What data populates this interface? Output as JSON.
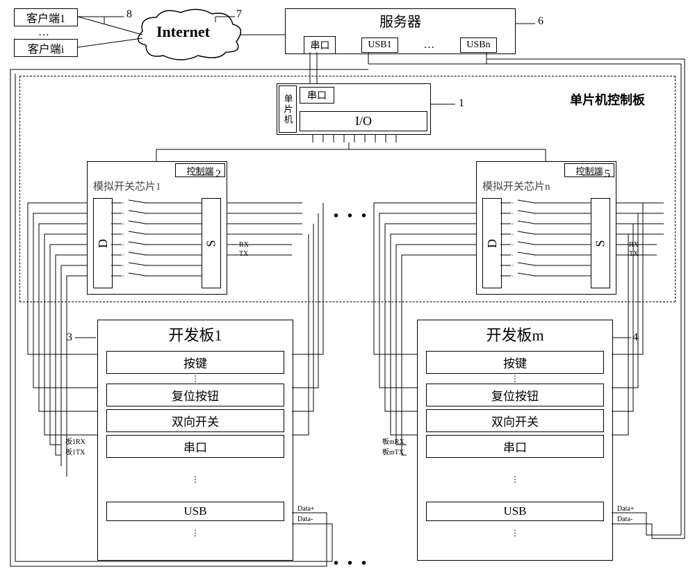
{
  "top": {
    "client1": "客户端1",
    "client_i": "客户端i",
    "client_dots": "…",
    "cloud": "Internet",
    "server": "服务器",
    "server_serial": "串口",
    "server_usb1": "USB1",
    "server_usb_dots": "…",
    "server_usbn": "USBn"
  },
  "callouts": {
    "c1": "1",
    "c2": "2",
    "c3": "3",
    "c4": "4",
    "c5": "5",
    "c6": "6",
    "c7": "7",
    "c8": "8"
  },
  "mcu": {
    "board_label": "单片机控制板",
    "chip_vert": "单片机",
    "serial": "串口",
    "io": "I/O"
  },
  "switch_chip": {
    "ctrl": "控制端",
    "name1": "模拟开关芯片1",
    "name_n": "模拟开关芯片n",
    "D": "D",
    "S": "S",
    "rx": "RX",
    "tx": "TX",
    "dots": "• • •"
  },
  "dev_board": {
    "title1": "开发板1",
    "title_m": "开发板m",
    "btn": "按键",
    "reset": "复位按钮",
    "bidir": "双向开关",
    "serial": "串口",
    "usb": "USB",
    "rx1": "板1RX",
    "tx1": "板1TX",
    "rxm": "板mRX",
    "txm": "板mTX",
    "data_p": "Data+",
    "data_m": "Data-",
    "inner_dots": "⋮",
    "outer_dots": "• • •"
  }
}
